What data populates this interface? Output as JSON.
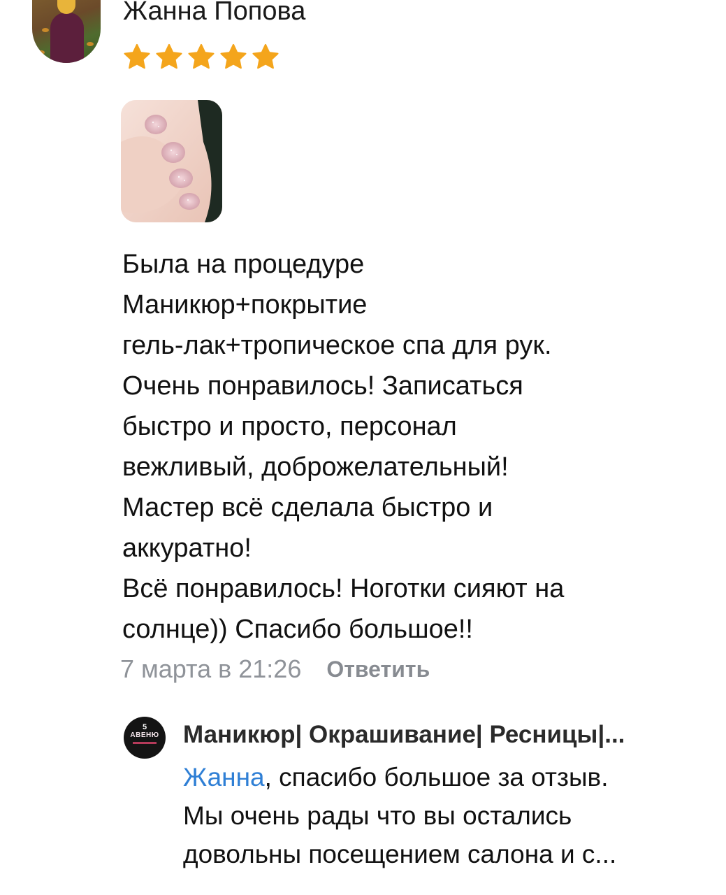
{
  "review": {
    "author_name": "Жанна Попова",
    "rating": 5,
    "rating_max": 5,
    "star_color": "#f4a51c",
    "star_icon": "star-icon",
    "text": "Была на процедуре\nМаникюр+покрытие\nгель-лак+тропическое спа для рук.\nОчень понравилось! Записаться\nбыстро и просто, персонал\nвежливый, доброжелательный!\nМастер всё сделала быстро и\nаккуратно!\nВсё понравилось! Ноготки сияют на\nсолнце)) Спасибо большое!!",
    "date": "7 марта в 21:26",
    "reply_label": "Ответить"
  },
  "reply": {
    "avatar_number": "5",
    "avatar_brand": "АВЕНЮ",
    "author": "Маникюр| Окрашивание| Ресницы|...",
    "mention": "Жанна",
    "text_after_mention": ", спасибо большое за отзыв.\nМы очень рады что вы остались\nдовольны посещением салона и с..."
  },
  "colors": {
    "mention_link": "#2f7fd5",
    "secondary_text": "#8f9399"
  }
}
